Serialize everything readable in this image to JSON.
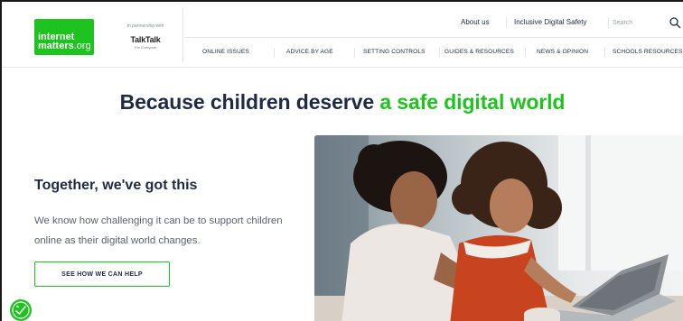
{
  "header": {
    "logo": {
      "line1": "internet",
      "line2": "matters",
      "line2_suffix": ".org"
    },
    "partner": {
      "label": "In partnership with",
      "name": "TalkTalk",
      "tagline": "For Everyone"
    },
    "top_links": [
      "About us",
      "Inclusive Digital Safety"
    ],
    "search": {
      "placeholder": "Search",
      "icon": "search-icon"
    }
  },
  "main_nav": [
    "ONLINE ISSUES",
    "ADVICE BY AGE",
    "SETTING CONTROLS",
    "GUIDES & RESOURCES",
    "NEWS & OPINION",
    "SCHOOLS RESOURCES"
  ],
  "hero": {
    "title_main": "Because children deserve ",
    "title_accent": "a safe digital world"
  },
  "content": {
    "subhead": "Together, we've got this",
    "body": "We know how challenging it can be to support children online as their digital world changes.",
    "cta_label": "SEE HOW WE CAN HELP"
  },
  "floating_button": {
    "icon": "accessibility-icon"
  },
  "colors": {
    "brand_green": "#1fc31f",
    "navy": "#1f2a44",
    "body_grey": "#5b6170",
    "divider": "#e3e6ea"
  }
}
